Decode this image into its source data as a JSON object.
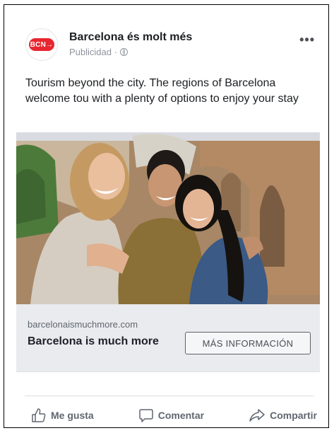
{
  "post": {
    "avatar_text": "BCN→",
    "page_name": "Barcelona és molt més",
    "sponsored": "Publicidad ·",
    "privacy_icon": "globe-icon",
    "text": "Tourism beyond the city. The regions of Barcelona welcome tou with a plenty of options to enjoy your stay"
  },
  "link_preview": {
    "domain": "barcelonaismuchmore.com",
    "title": "Barcelona is much more",
    "cta_label": "MÁS INFORMACIÓN"
  },
  "actions": [
    {
      "label": "Me gusta",
      "icon": "like-icon"
    },
    {
      "label": "Comentar",
      "icon": "comment-icon"
    },
    {
      "label": "Compartir",
      "icon": "share-icon"
    }
  ],
  "colors": {
    "brand_red": "#e8262f",
    "muted_text": "#606770",
    "cta_background": "#e9ebee"
  }
}
